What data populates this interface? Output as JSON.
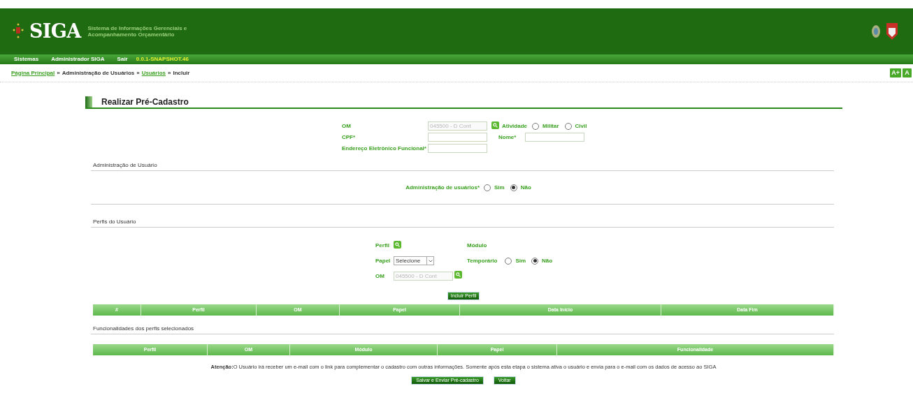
{
  "header": {
    "logo": "SIGA",
    "subtitle_lines": [
      "Sistema de Informações Gerenciais e",
      "Acompanhamento Orçamentário"
    ]
  },
  "menu": {
    "items": [
      "Sistemas",
      "Administrador SIGA",
      "Sair"
    ],
    "version": "0.0.1-SNAPSHOT.46"
  },
  "breadcrumb": [
    {
      "label": "Página Principal",
      "link": true
    },
    {
      "label": "Administração de Usuários",
      "link": false
    },
    {
      "label": "Usuários",
      "link": true
    },
    {
      "label": "Incluir",
      "link": false
    }
  ],
  "breadcrumb_separator": "»",
  "font_buttons": [
    "A+",
    "A"
  ],
  "page_title": "Realizar Pré-Cadastro",
  "form": {
    "om": {
      "label": "OM",
      "value": "045500 - D Cont",
      "disabled": true
    },
    "atividade": {
      "label": "Atividade",
      "options": [
        {
          "label": "Militar",
          "selected": false
        },
        {
          "label": "Civil",
          "selected": false
        }
      ]
    },
    "cpf": {
      "label": "CPF*"
    },
    "nome": {
      "label": "Nome*"
    },
    "email": {
      "label": "Endereço Eletrônico Funcional*"
    }
  },
  "admin_section": {
    "title": "Administração de Usuário",
    "label": "Administração de usuários*",
    "options": [
      {
        "label": "Sim",
        "selected": false
      },
      {
        "label": "Não",
        "selected": true
      }
    ]
  },
  "profiles_section": {
    "title": "Perfis do Usuário",
    "perfil_label": "Perfil",
    "modulo_label": "Módulo",
    "papel": {
      "label": "Papel",
      "value": "Selecione"
    },
    "temporario": {
      "label": "Temporário",
      "options": [
        {
          "label": "Sim",
          "selected": false
        },
        {
          "label": "Não",
          "selected": true
        }
      ]
    },
    "om": {
      "label": "OM",
      "value": "045500 - D Cont",
      "disabled": true
    },
    "add_button": "Incluir Perfil"
  },
  "profiles_table": {
    "columns": [
      "#",
      "Perfil",
      "OM",
      "Papel",
      "Data Início",
      "Data Fim"
    ]
  },
  "functions_section": {
    "title": "Funcionalidades dos perfis selecionados"
  },
  "functions_table": {
    "columns": [
      "Perfil",
      "OM",
      "Módulo",
      "Papel",
      "Funcionalidade"
    ]
  },
  "notice": "**Atenção:**O Usuário irá receber um e-mail com o link para complementar o cadastro com outras informações. Somente após esta etapa o sistema ativa o usuário e envia para o e-mail com os dados de acesso ao SIGA",
  "buttons": [
    "Salvar e Enviar Pré-cadastro",
    "Voltar"
  ]
}
